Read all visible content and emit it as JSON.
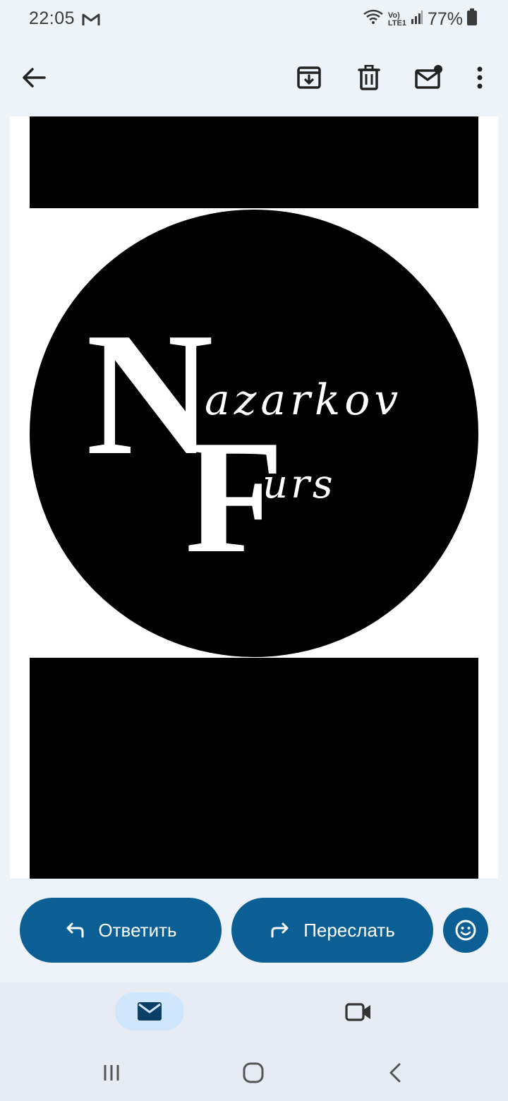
{
  "status": {
    "time": "22:05",
    "network_top": "Vo)",
    "network_bottom": "LTE1",
    "battery": "77%"
  },
  "toolbar": {
    "icons": [
      "back-arrow-icon",
      "archive-icon",
      "trash-icon",
      "mark-unread-icon",
      "more-vert-icon"
    ]
  },
  "email": {
    "logo_text": {
      "big_letter_1": "N",
      "script_1": "azarkov",
      "big_letter_2": "F",
      "script_2": "urs"
    }
  },
  "actions": {
    "reply_label": "Ответить",
    "forward_label": "Переслать"
  },
  "bottom_nav": {
    "items": [
      "mail-icon",
      "video-icon"
    ]
  },
  "colors": {
    "accent": "#0b5f95",
    "pill": "#cfe6fb",
    "background": "#eef2f9"
  }
}
